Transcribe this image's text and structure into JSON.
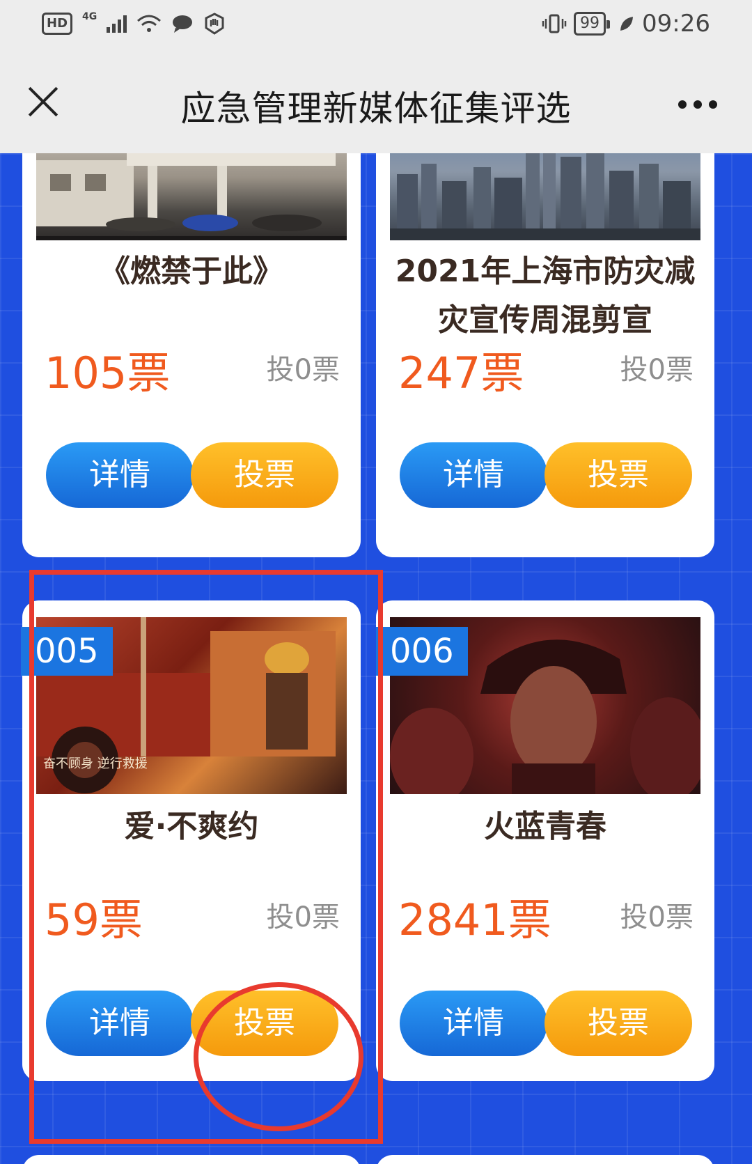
{
  "status_bar": {
    "hd": "HD",
    "network": "4G",
    "battery": "99",
    "time": "09:26"
  },
  "title_bar": {
    "title": "应急管理新媒体征集评选"
  },
  "cards": [
    {
      "badge": "",
      "title": "《燃禁于此》",
      "votes": "105票",
      "vote_label": "投0票",
      "detail_label": "详情",
      "vote_button_label": "投票"
    },
    {
      "badge": "",
      "title": "2021年上海市防灾减灾宣传周混剪宣",
      "votes": "247票",
      "vote_label": "投0票",
      "detail_label": "详情",
      "vote_button_label": "投票"
    },
    {
      "badge": "005",
      "title": "爱·不爽约",
      "thumb_caption": "奋不顾身 逆行救援",
      "votes": "59票",
      "vote_label": "投0票",
      "detail_label": "详情",
      "vote_button_label": "投票"
    },
    {
      "badge": "006",
      "title": "火蓝青春",
      "votes": "2841票",
      "vote_label": "投0票",
      "detail_label": "详情",
      "vote_button_label": "投票"
    }
  ],
  "colors": {
    "background": "#1f4fe0",
    "vote_count": "#f05a1e",
    "detail_button": "#1a7fe6",
    "vote_button": "#fbab18",
    "annotation": "#e83a2e"
  }
}
